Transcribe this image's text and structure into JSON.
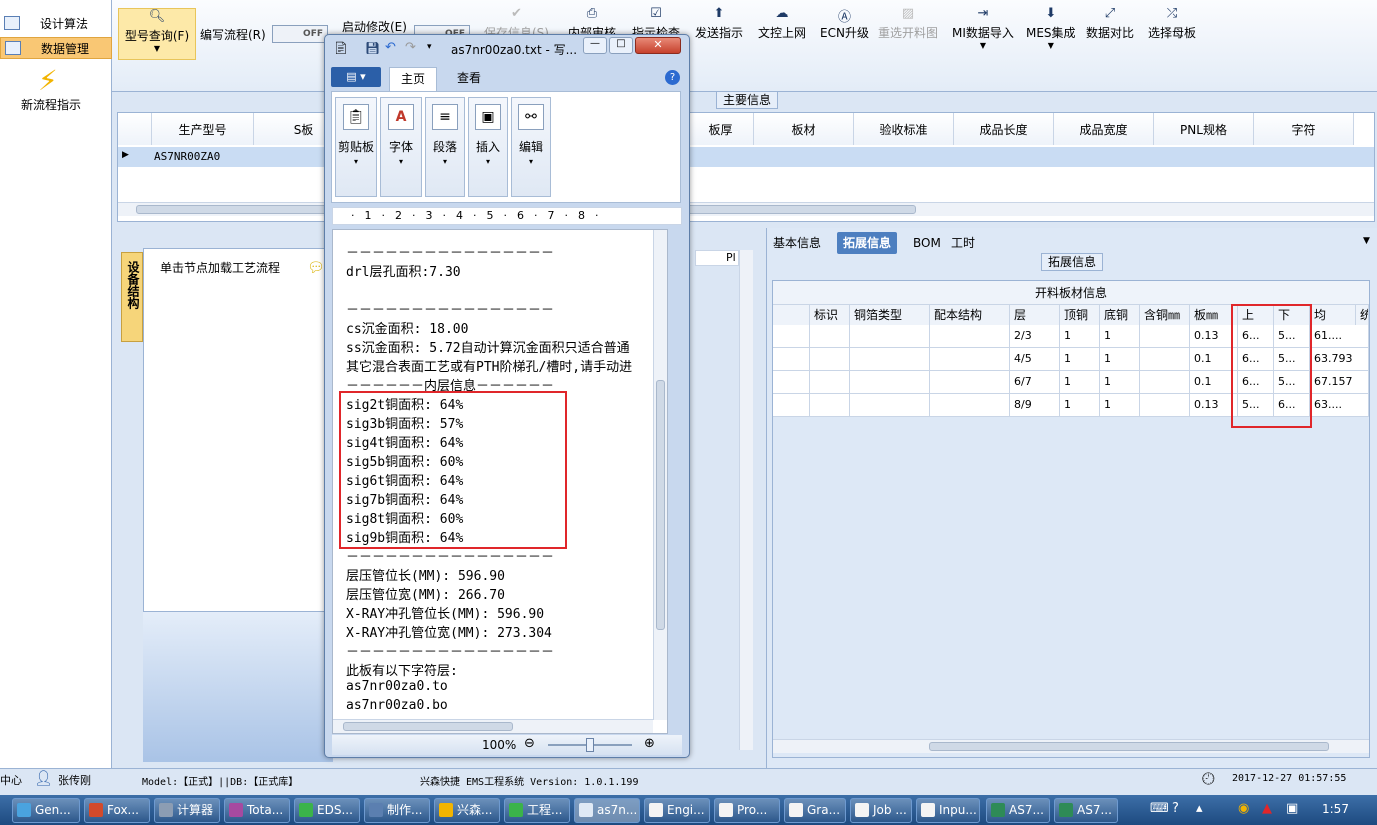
{
  "nav": {
    "items": [
      {
        "label": "设计算法"
      },
      {
        "label": "数据管理"
      },
      {
        "label": "新流程指示"
      }
    ]
  },
  "ribbon": {
    "buttons": [
      {
        "label": "型号查询(F)",
        "icon": "search-icon"
      },
      {
        "label": "编写流程(R)",
        "icon": ""
      },
      {
        "label": "启动修改(E)",
        "icon": ""
      },
      {
        "label": "保存信息(S)",
        "icon": "check-icon"
      },
      {
        "label": "内部审核",
        "icon": "print-icon"
      },
      {
        "label": "指示检查",
        "icon": "checkbox-icon"
      },
      {
        "label": "发送指示",
        "icon": "upload-icon"
      },
      {
        "label": "文控上网",
        "icon": "cloud-upload-icon"
      },
      {
        "label": "ECN升级",
        "icon": "ecn-icon"
      },
      {
        "label": "重选开料图",
        "icon": "image-icon"
      },
      {
        "label": "MI数据导入",
        "icon": "import-icon"
      },
      {
        "label": "MES集成",
        "icon": "download-icon"
      },
      {
        "label": "数据对比",
        "icon": "compare-icon"
      },
      {
        "label": "选择母板",
        "icon": "shuffle-icon"
      }
    ],
    "toggle1": "OFF",
    "toggle2": "OFF"
  },
  "main_info": {
    "title": "主要信息",
    "columns": [
      "生产型号",
      "S板",
      "板厚",
      "板材",
      "验收标准",
      "成品长度",
      "成品宽度",
      "PNL规格",
      "字符"
    ],
    "row": {
      "model": "AS7NR00ZA0"
    }
  },
  "flow": {
    "side_tab": "设备结构",
    "hint": "单击节点加载工艺流程",
    "col_label": "Pl"
  },
  "right": {
    "tabs": [
      "基本信息",
      "拓展信息",
      "BOM",
      "工时"
    ],
    "group_title": "拓展信息",
    "grid_title": "开料板材信息",
    "columns": [
      "标识",
      "铜箔类型",
      "配本结构",
      "层",
      "顶铜",
      "底铜",
      "含铜㎜",
      "板㎜",
      "上",
      "下",
      "均",
      "统"
    ],
    "rows": [
      {
        "layer": "2/3",
        "top": "1",
        "bottom": "1",
        "thick": "0.13",
        "up": "6...",
        "down": "5...",
        "avg": "61...."
      },
      {
        "layer": "4/5",
        "top": "1",
        "bottom": "1",
        "thick": "0.1",
        "up": "6...",
        "down": "5...",
        "avg": "63.793"
      },
      {
        "layer": "6/7",
        "top": "1",
        "bottom": "1",
        "thick": "0.1",
        "up": "6...",
        "down": "5...",
        "avg": "67.157"
      },
      {
        "layer": "8/9",
        "top": "1",
        "bottom": "1",
        "thick": "0.13",
        "up": "5...",
        "down": "6...",
        "avg": "63...."
      }
    ]
  },
  "wordpad": {
    "title": "as7nr00za0.txt - 写...",
    "tabs": [
      "主页",
      "查看"
    ],
    "groups": [
      "剪贴板",
      "字体",
      "段落",
      "插入",
      "编辑"
    ],
    "ruler": "·1·2·3·4·5·6·7·8·",
    "lines": [
      "－－－－－－－－－－－－－－－－",
      "drl层孔面积:7.30",
      "",
      "－－－－－－－－－－－－－－－－",
      "cs沉金面积: 18.00",
      "ss沉金面积: 5.72自动计算沉金面积只适合普通",
      "其它混合表面工艺或有PTH阶梯孔/槽时,请手动进",
      "－－－－－－内层信息－－－－－－",
      "sig2t铜面积: 64%",
      "sig3b铜面积: 57%",
      "sig4t铜面积: 64%",
      "sig5b铜面积: 60%",
      "sig6t铜面积: 64%",
      "sig7b铜面积: 64%",
      "sig8t铜面积: 60%",
      "sig9b铜面积: 64%",
      "－－－－－－－－－－－－－－－－",
      "层压管位长(MM): 596.90",
      "层压管位宽(MM): 266.70",
      "X-RAY冲孔管位长(MM): 596.90",
      "X-RAY冲孔管位宽(MM): 273.304",
      "－－－－－－－－－－－－－－－－",
      "此板有以下字符层:",
      "as7nr00za0.to",
      "as7nr00za0.bo"
    ],
    "zoom": "100%"
  },
  "status": {
    "left": "中心",
    "user": "张传刚",
    "model": "Model:【正式】||DB:【正式库】",
    "system": "兴森快捷 EMS工程系统 Version: 1.0.1.199",
    "datetime": "2017-12-27 01:57:55"
  },
  "taskbar": {
    "items": [
      "Gen...",
      "Fox...",
      "计算器",
      "Tota...",
      "EDS...",
      "制作...",
      "兴森...",
      "工程...",
      "as7n...",
      "Engi...",
      "Pro...",
      "Gra...",
      "Job ...",
      "Inpu...",
      "AS7...",
      "AS7..."
    ],
    "clock": "1:57"
  }
}
